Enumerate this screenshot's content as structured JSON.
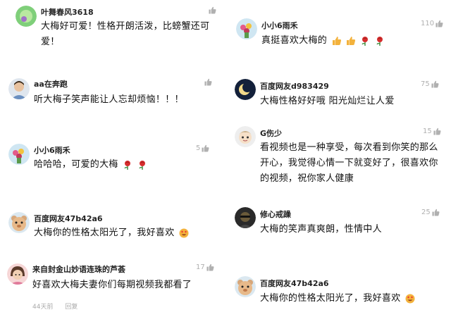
{
  "comments_left": [
    {
      "user": "叶舞春风3618",
      "text": "大梅好可爱！性格开朗活泼，比螃蟹还可爱！",
      "likes": "",
      "avatar": "green-circle-avatar"
    },
    {
      "user": "aa在奔跑",
      "text": "听大梅子笑声能让人忘却烦恼！！！",
      "likes": "",
      "avatar": "person-avatar"
    },
    {
      "user": "小小6雨禾",
      "text": "哈哈哈，可爱的大梅",
      "likes": "5",
      "avatar": "flowers-avatar"
    },
    {
      "user": "百度网友47b42a6",
      "text": "大梅你的性格太阳光了，我好喜欢",
      "likes": "",
      "avatar": "bear-avatar"
    },
    {
      "user": "来自封金山妙语连珠的芦荟",
      "text": "好喜欢大梅夫妻你们每期视频我都看了",
      "likes": "17",
      "avatar": "girl-avatar",
      "time": "44天前",
      "reply": "回复"
    }
  ],
  "comments_right": [
    {
      "user": "小小6雨禾",
      "text": "真挺喜欢大梅的",
      "likes": "110",
      "avatar": "flowers-avatar"
    },
    {
      "user": "百度网友d983429",
      "text": "大梅性格好好哦 阳光灿烂让人爱",
      "likes": "75",
      "avatar": "moon-avatar"
    },
    {
      "user": "G伤少",
      "text": "看视频也是一种享受，每次看到你笑的那么开心，我觉得心情一下就变好了，很喜欢你的视频，祝你家人健康",
      "likes": "15",
      "avatar": "cartoon-avatar"
    },
    {
      "user": "修心戒躁",
      "text": "大梅的笑声真爽朗，性情中人",
      "likes": "25",
      "avatar": "dark-avatar"
    },
    {
      "user": "百度网友47b42a6",
      "text": "大梅你的性格太阳光了，我好喜欢",
      "likes": "",
      "avatar": "bear-avatar"
    }
  ],
  "colors": {
    "like": "#b0b0b0",
    "rose": "#d62d2d",
    "thumb": "#f3b23c"
  }
}
